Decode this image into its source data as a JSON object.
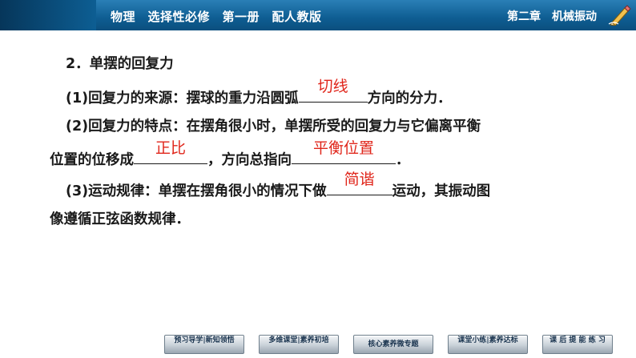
{
  "header": {
    "book": "物理　选择性必修　第一册　配人教版",
    "chapter": "第二章　机械振动",
    "pencil_icon": "pencil-icon"
  },
  "content": {
    "heading": "2．单摆的回复力",
    "p1_prefix": "(1)回复力的来源：摆球的重力沿圆弧",
    "p1_answer": "切线",
    "p1_suffix": "方向的分力．",
    "p2_line1": "(2)回复力的特点：在摆角很小时，单摆所受的回复力与它偏离平衡",
    "p2_line2_prefix": "位置的位移成",
    "p2_answer1": "正比",
    "p2_line2_mid": "，方向总指向",
    "p2_answer2": "平衡位置",
    "p2_line2_suffix": "．",
    "p3_prefix": "(3)运动规律：单摆在摆角很小的情况下做",
    "p3_answer": "简谐",
    "p3_suffix": "运动，其振动图",
    "p3_line2": "像遵循正弦函数规律．"
  },
  "nav": [
    {
      "label": "预习导学|新知领悟"
    },
    {
      "label": "多维课堂|素养初培"
    },
    {
      "label": "核心素养微专题"
    },
    {
      "label": "课堂小练|素养达标"
    },
    {
      "label": "课 后 提 能 练 习"
    }
  ],
  "colors": {
    "header_bg": "#0e5d92",
    "answer": "#e0261b",
    "text": "#1a1a1a"
  }
}
